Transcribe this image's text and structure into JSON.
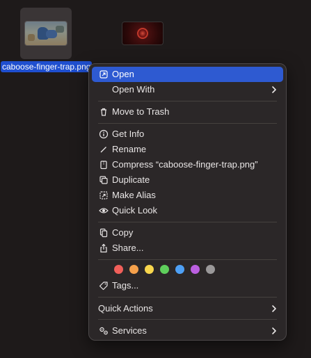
{
  "desktop": {
    "selected_file": {
      "name": "caboose-finger-trap.png",
      "icon": "image-thumbnail-icon"
    },
    "other_file": {
      "icon": "image-thumbnail-icon"
    }
  },
  "context_menu": {
    "open": "Open",
    "open_with": "Open With",
    "move_to_trash": "Move to Trash",
    "get_info": "Get Info",
    "rename": "Rename",
    "compress": "Compress “caboose-finger-trap.png”",
    "duplicate": "Duplicate",
    "make_alias": "Make Alias",
    "quick_look": "Quick Look",
    "copy": "Copy",
    "share": "Share...",
    "tags": "Tags...",
    "quick_actions": "Quick Actions",
    "services": "Services",
    "tag_colors": [
      "#f15f5a",
      "#f5a04b",
      "#f8d64d",
      "#5fcf5c",
      "#4ea0f5",
      "#bb5fe0",
      "#9a9899"
    ],
    "highlight_color": "#2e5ad1"
  }
}
